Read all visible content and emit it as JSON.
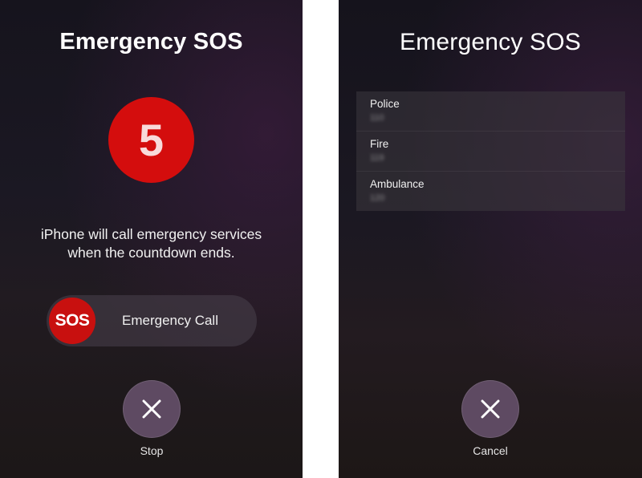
{
  "left_screen": {
    "title": "Emergency SOS",
    "countdown": "5",
    "message_line1": "iPhone will call emergency services",
    "message_line2": "when the countdown ends.",
    "slider_knob_label": "SOS",
    "slider_label": "Emergency Call",
    "stop_button_icon": "close-icon",
    "stop_label": "Stop"
  },
  "right_screen": {
    "title": "Emergency SOS",
    "services": [
      {
        "label": "Police",
        "number": "110"
      },
      {
        "label": "Fire",
        "number": "119"
      },
      {
        "label": "Ambulance",
        "number": "120"
      }
    ],
    "cancel_button_icon": "close-icon",
    "cancel_label": "Cancel"
  },
  "colors": {
    "sos_red": "#d40d0d",
    "button_purple": "#5e4a62",
    "divider_white": "#ffffff"
  }
}
